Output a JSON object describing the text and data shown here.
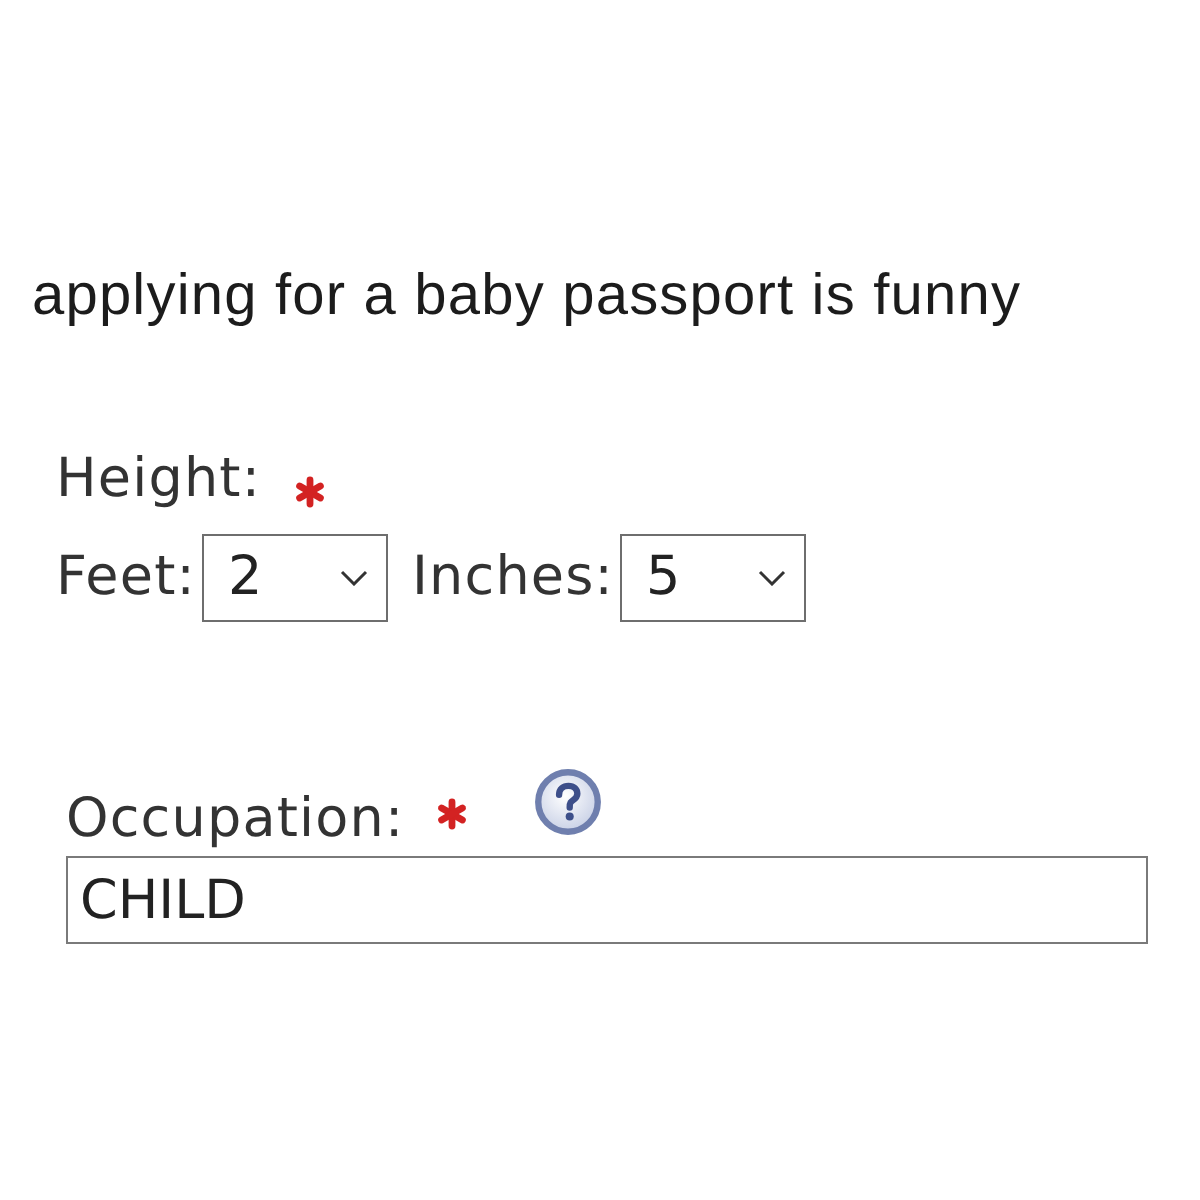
{
  "caption": "applying for a baby passport is funny",
  "height": {
    "label": "Height:",
    "required": true,
    "fields": [
      {
        "label": "Feet:",
        "value": "2"
      },
      {
        "label": "Inches:",
        "value": "5"
      }
    ]
  },
  "occupation": {
    "label": "Occupation:",
    "required": true,
    "value": "CHILD"
  }
}
